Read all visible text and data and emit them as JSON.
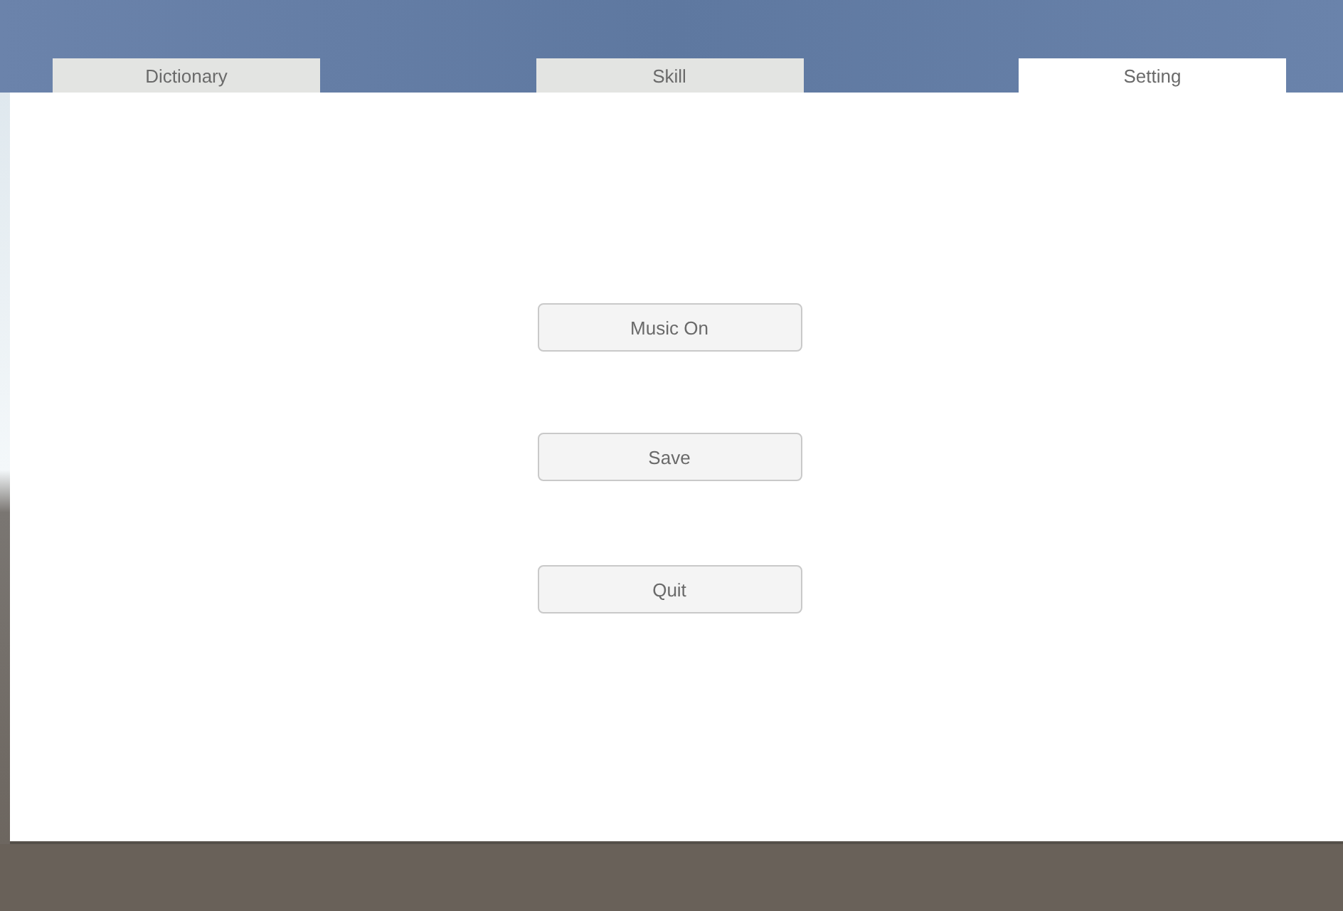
{
  "tabs": [
    {
      "label": "Dictionary",
      "selected": false
    },
    {
      "label": "Skill",
      "selected": false
    },
    {
      "label": "Setting",
      "selected": true
    }
  ],
  "buttons": [
    {
      "label": "Music On"
    },
    {
      "label": "Save"
    },
    {
      "label": "Quit"
    }
  ]
}
